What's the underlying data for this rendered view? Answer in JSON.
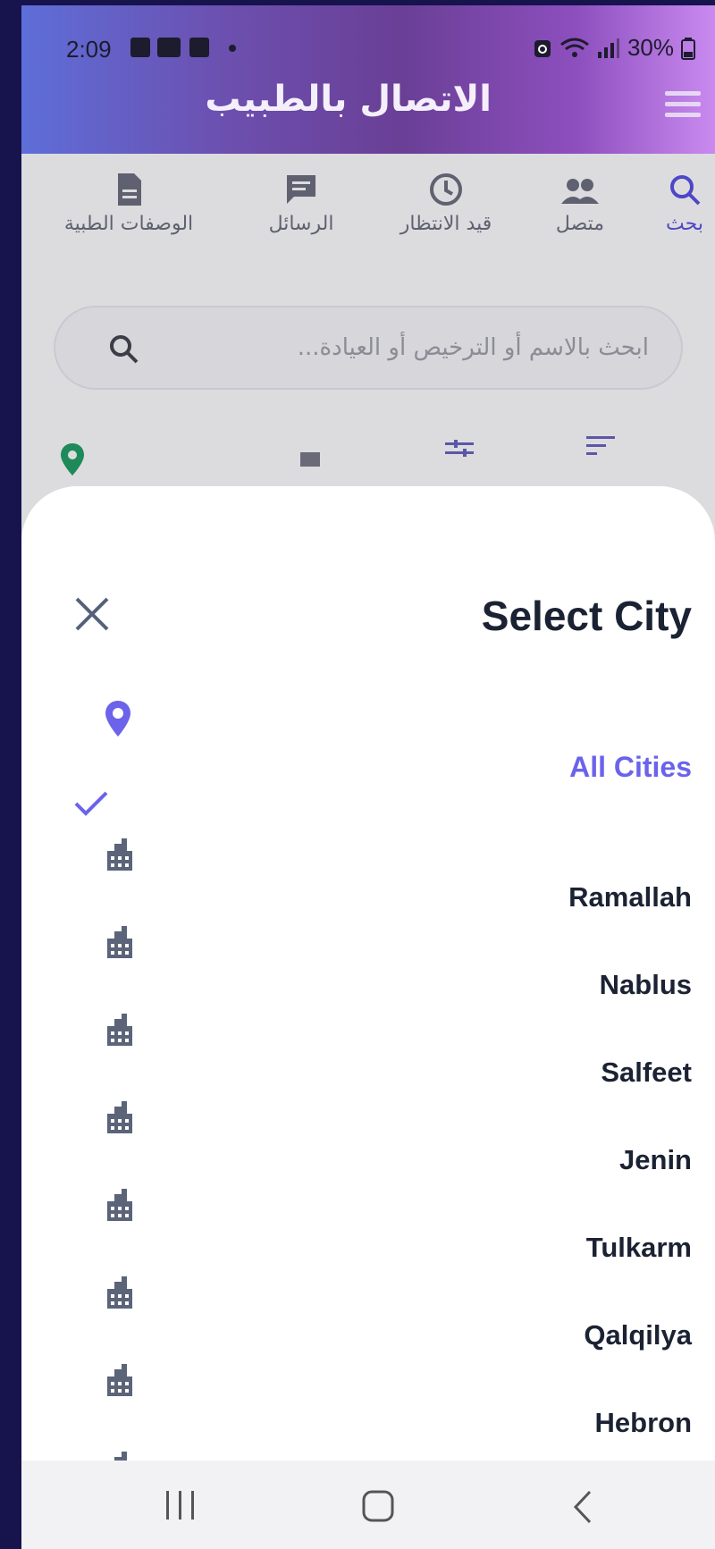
{
  "status_bar": {
    "time": "2:09",
    "battery": "30%"
  },
  "header": {
    "title": "الاتصال بالطبيب"
  },
  "tabs": [
    {
      "label": "بحث",
      "icon": "search-icon",
      "active": true
    },
    {
      "label": "متصل",
      "icon": "people-icon",
      "active": false
    },
    {
      "label": "قيد الانتظار",
      "icon": "clock-icon",
      "active": false
    },
    {
      "label": "الرسائل",
      "icon": "message-icon",
      "active": false
    },
    {
      "label": "الوصفات الطبية",
      "icon": "document-icon",
      "active": false
    }
  ],
  "search": {
    "placeholder": "ابحث بالاسم أو الترخيص أو العيادة..."
  },
  "sheet": {
    "title": "Select City",
    "all_cities": "All Cities",
    "cities": [
      {
        "name": "Ramallah"
      },
      {
        "name": "Nablus"
      },
      {
        "name": "Salfeet"
      },
      {
        "name": "Jenin"
      },
      {
        "name": "Tulkarm"
      },
      {
        "name": "Qalqilya"
      },
      {
        "name": "Hebron"
      }
    ]
  },
  "colors": {
    "accent": "#6b63ea",
    "text_dark": "#1b2233",
    "city_icon": "#5b6478"
  }
}
